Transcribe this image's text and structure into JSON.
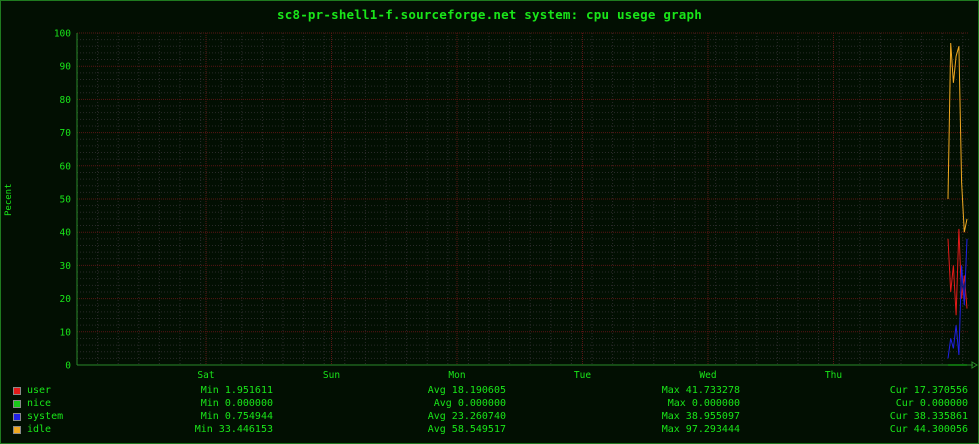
{
  "title": "sc8-pr-shell1-f.sourceforge.net system: cpu usege graph",
  "colors": {
    "background": "#020f02",
    "text": "#19e619",
    "grid_major": "#5a1414",
    "grid_minor": "#2a2a2a",
    "axis": "#2a8a2a"
  },
  "chart_data": {
    "type": "line",
    "ylabel": "Pecent",
    "ylim": [
      0,
      100
    ],
    "y_ticks": [
      "0",
      "10",
      "20",
      "30",
      "40",
      "50",
      "60",
      "70",
      "80",
      "90",
      "100"
    ],
    "x_ticks": [
      "Sat",
      "Sun",
      "Mon",
      "Tue",
      "Wed",
      "Thu"
    ],
    "grid": true,
    "legend_position": "bottom",
    "series": [
      {
        "name": "user",
        "color": "#e41a1a",
        "values": [
          38,
          22,
          30,
          15,
          41,
          20,
          27,
          17
        ]
      },
      {
        "name": "nice",
        "color": "#19c819",
        "values": [
          0,
          0,
          0,
          0,
          0,
          0,
          0,
          0
        ]
      },
      {
        "name": "system",
        "color": "#2020e6",
        "values": [
          2,
          8,
          5,
          12,
          3,
          30,
          18,
          38
        ]
      },
      {
        "name": "idle",
        "color": "#f0a820",
        "values": [
          50,
          97,
          85,
          93,
          96,
          55,
          40,
          44
        ]
      }
    ]
  },
  "legend": [
    {
      "name": "user",
      "color": "#e41a1a",
      "min": "Min 1.951611",
      "avg": "Avg 18.190605",
      "max": "Max 41.733278",
      "cur": "Cur 17.370556"
    },
    {
      "name": "nice",
      "color": "#19c819",
      "min": "Min 0.000000",
      "avg": "Avg 0.000000",
      "max": "Max 0.000000",
      "cur": "Cur 0.000000"
    },
    {
      "name": "system",
      "color": "#2020e6",
      "min": "Min 0.754944",
      "avg": "Avg 23.260740",
      "max": "Max 38.955097",
      "cur": "Cur 38.335861"
    },
    {
      "name": "idle",
      "color": "#f0a820",
      "min": "Min 33.446153",
      "avg": "Avg 58.549517",
      "max": "Max 97.293444",
      "cur": "Cur 44.300056"
    }
  ]
}
